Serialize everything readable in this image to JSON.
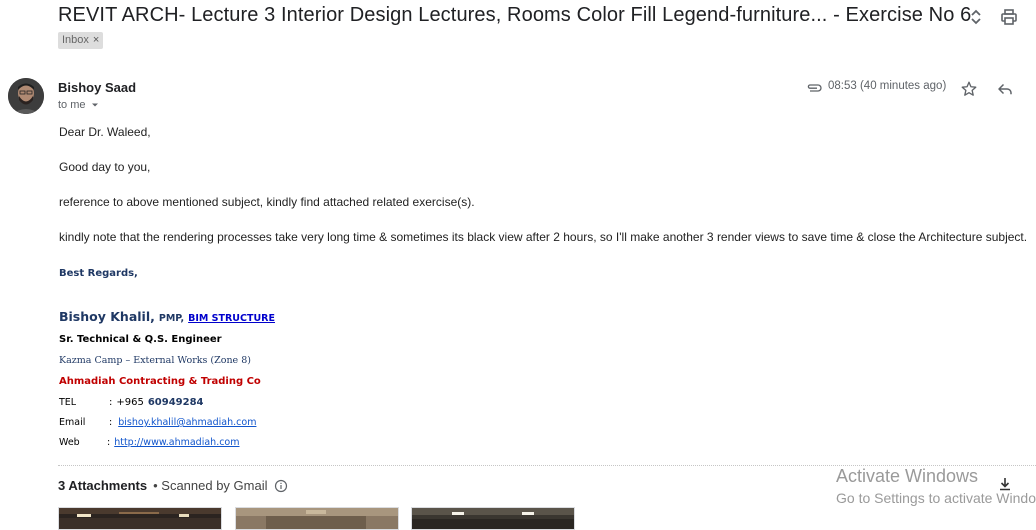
{
  "message": {
    "subject": "REVIT ARCH- Lecture 3 Interior Design Lectures, Rooms Color Fill Legend-furniture... - Exercise No 6",
    "label_chip": "Inbox",
    "label_chip_close": "×",
    "sender_name": "Bishoy Saad",
    "recipient_text": "to me",
    "timestamp": "08:53 (40 minutes ago)"
  },
  "body": {
    "greeting": "Dear Dr. Waleed,",
    "line1": "Good day to you,",
    "line2": "reference to above mentioned subject, kindly find attached related exercise(s).",
    "line3": "kindly note that the rendering processes take very long time & sometimes its black view after 2 hours, so I'll make another 3 render views to save time & close the Architecture subject."
  },
  "signature": {
    "regards": "Best Regards,",
    "name": "Bishoy Khalil,",
    "credential": "PMP,",
    "credential_link": "BIM STRUCTURE",
    "title": "Sr. Technical & Q.S. Engineer",
    "location": "Kazma Camp – External Works (Zone 8)",
    "company": "Ahmadiah Contracting & Trading Co",
    "tel_label": "TEL",
    "tel_sep": ":",
    "tel_prefix": "+965",
    "tel_number": "60949284",
    "email_label": "Email",
    "email_sep": ":",
    "email_value": "bishoy.khalil@ahmadiah.com",
    "web_label": "Web",
    "web_sep": ":",
    "web_value": "http://www.ahmadiah.com"
  },
  "attachments": {
    "title": "3 Attachments",
    "scan_text": "• Scanned by Gmail"
  },
  "watermark": {
    "line1": "Activate Windows",
    "line2": "Go to Settings to activate Windows."
  },
  "colors": {
    "link": "#1155cc",
    "company_red": "#c00000",
    "signature_navy": "#1f3864"
  },
  "icons": [
    "expand-collapse-icon",
    "print-icon",
    "attachment-clip-icon",
    "star-icon",
    "reply-icon",
    "dropdown-arrow-icon",
    "info-icon",
    "download-icon"
  ]
}
